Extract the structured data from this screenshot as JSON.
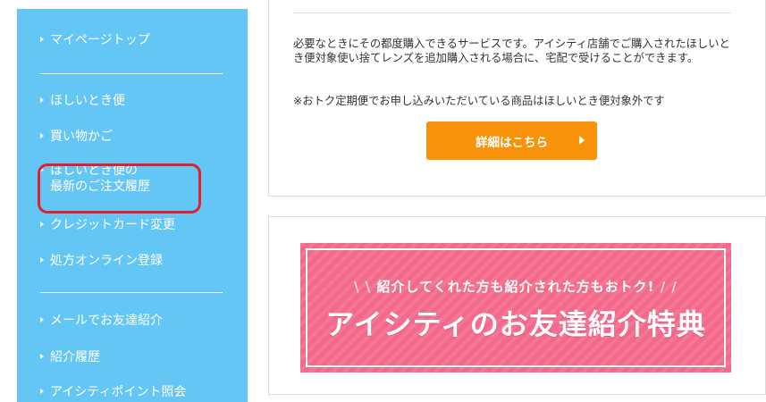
{
  "sidebar": {
    "items": [
      {
        "label": "マイページトップ"
      },
      {
        "label": "ほしいとき便"
      },
      {
        "label": "買い物かご"
      },
      {
        "label": "ほしいとき便の\n最新のご注文履歴"
      },
      {
        "label": "クレジットカード変更"
      },
      {
        "label": "処方オンライン登録"
      },
      {
        "label": "メールでお友達紹介"
      },
      {
        "label": "紹介履歴"
      },
      {
        "label": "アイシティポイント照会"
      }
    ]
  },
  "info_card": {
    "description": "必要なときにその都度購入できるサービスです。アイシティ店舗でご購入されたほしいとき便対象使い捨てレンズを追加購入される場合に、宅配で受けることができます。",
    "note": "※おトク定期便でお申し込みいただいている商品はほしいとき便対象外です",
    "detail_button_label": "詳細はこちら"
  },
  "banner": {
    "subtitle": "紹介してくれた方も紹介された方もおトク!",
    "title": "アイシティのお友達紹介特典"
  },
  "colors": {
    "sidebar_bg": "#64c6f4",
    "button_orange": "#f7920a",
    "banner_pink": "#f4688a",
    "highlight_red": "#e1202b"
  }
}
